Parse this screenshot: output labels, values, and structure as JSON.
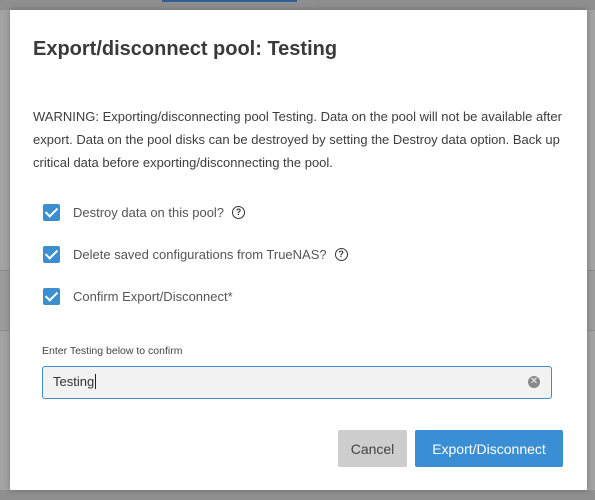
{
  "dialog": {
    "title": "Export/disconnect pool: Testing",
    "warning": "WARNING: Exporting/disconnecting pool Testing. Data on the pool will not be available after export. Data on the pool disks can be destroyed by setting the Destroy data option. Back up critical data before exporting/disconnecting the pool.",
    "options": [
      {
        "label": "Destroy data on this pool?",
        "checked": true,
        "has_help": true,
        "help_icon": "help-circle-icon"
      },
      {
        "label": "Delete saved configurations from TrueNAS?",
        "checked": true,
        "has_help": true,
        "help_icon": "help-circle-icon"
      },
      {
        "label": "Confirm Export/Disconnect*",
        "checked": true,
        "has_help": false
      }
    ],
    "confirm_field": {
      "label": "Enter Testing below to confirm",
      "value": "Testing",
      "clear_icon": "clear-circle-icon"
    },
    "buttons": {
      "cancel": "Cancel",
      "export": "Export/Disconnect"
    }
  },
  "colors": {
    "accent": "#3a8ed3",
    "cancel_bg": "#cdcdcd",
    "backdrop": "#a3a3a3"
  }
}
